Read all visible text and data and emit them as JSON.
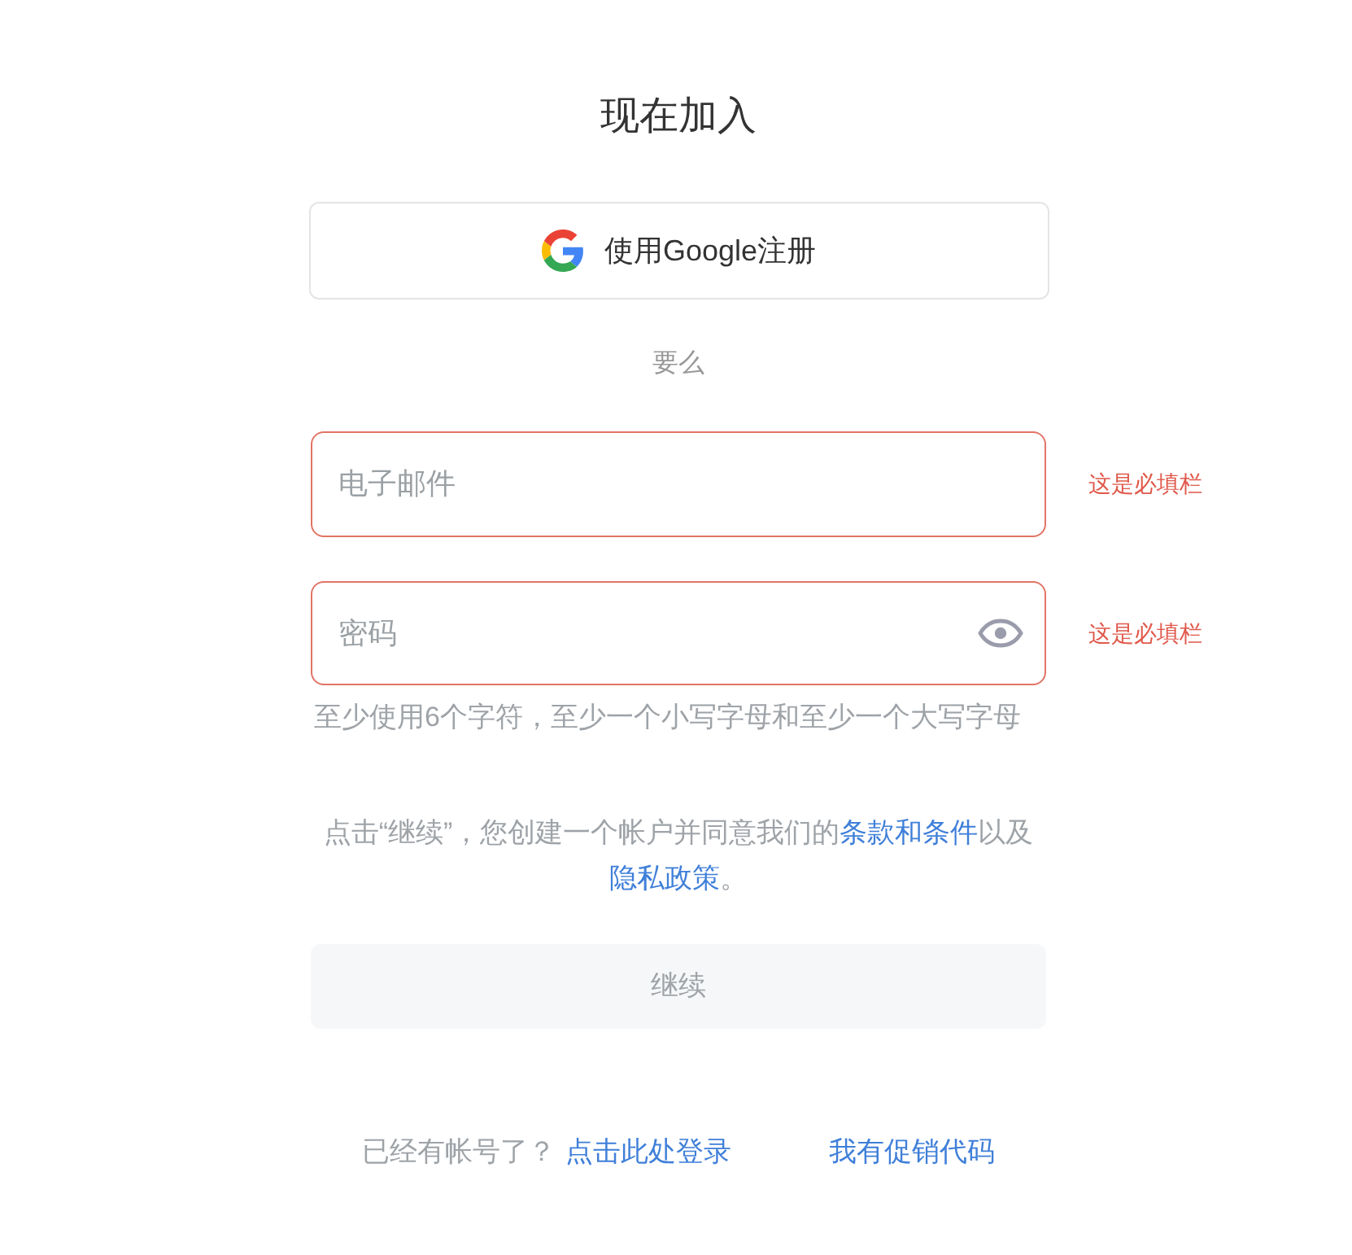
{
  "title": "现在加入",
  "google_button": {
    "label": "使用Google注册"
  },
  "divider_text": "要么",
  "fields": [
    {
      "kind": "email",
      "placeholder": "电子邮件",
      "invalid": true,
      "error": "这是必填栏"
    },
    {
      "kind": "password",
      "placeholder": "密码",
      "invalid": true,
      "error": "这是必填栏",
      "hint": "至少使用6个字符，至少一个小写字母和至少一个大写字母"
    }
  ],
  "terms": [
    {
      "kind": "text",
      "text": "点击“继续”，您创建一个帐户并同意我们的"
    },
    {
      "kind": "link",
      "text": "条款和条件"
    },
    {
      "kind": "text",
      "text": "以及"
    },
    {
      "kind": "link",
      "text": "隐私政策"
    },
    {
      "kind": "text",
      "text": "。"
    }
  ],
  "continue_button": {
    "label": "继续",
    "disabled": true
  },
  "footer": {
    "prompt": "已经有帐号了？",
    "login_link": "点击此处登录",
    "promo_link": "我有促销代码"
  }
}
